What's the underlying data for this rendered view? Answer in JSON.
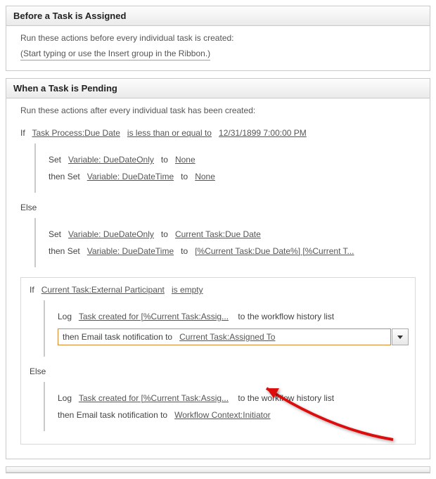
{
  "stage1": {
    "title": "Before a Task is Assigned",
    "desc": "Run these actions before every individual task is created:",
    "placeholder": "(Start typing or use the Insert group in the Ribbon.)"
  },
  "stage2": {
    "title": "When a Task is Pending",
    "desc": "Run these actions after every individual task has been created:",
    "cond1": {
      "if": "If",
      "field": "Task Process:Due Date",
      "op": "is less than or equal to",
      "value": "12/31/1899 7:00:00 PM"
    },
    "c1_a1": {
      "pre": "Set",
      "var": "Variable: DueDateOnly",
      "mid": "to",
      "val": "None"
    },
    "c1_a2": {
      "pre": "then Set",
      "var": "Variable: DueDateTime",
      "mid": "to",
      "val": "None"
    },
    "else1": "Else",
    "c1_e1": {
      "pre": "Set",
      "var": "Variable: DueDateOnly",
      "mid": "to",
      "val": "Current Task:Due Date"
    },
    "c1_e2": {
      "pre": "then Set",
      "var": "Variable: DueDateTime",
      "mid": "to",
      "val": "[%Current Task:Due Date%] [%Current T..."
    },
    "cond2": {
      "if": "If",
      "field": "Current Task:External Participant",
      "op": "is empty"
    },
    "c2_a1": {
      "pre": "Log",
      "msg": "Task created for [%Current Task:Assig...",
      "suffix": "to the workflow history list"
    },
    "c2_a2": {
      "pre": "then Email task notification to",
      "target": "Current Task:Assigned To"
    },
    "else2": "Else",
    "c2_e1": {
      "pre": "Log",
      "msg": "Task created for [%Current Task:Assig...",
      "suffix": "to the workflow history list"
    },
    "c2_e2": {
      "pre": "then Email task notification to",
      "target": "Workflow Context:Initiator"
    }
  }
}
